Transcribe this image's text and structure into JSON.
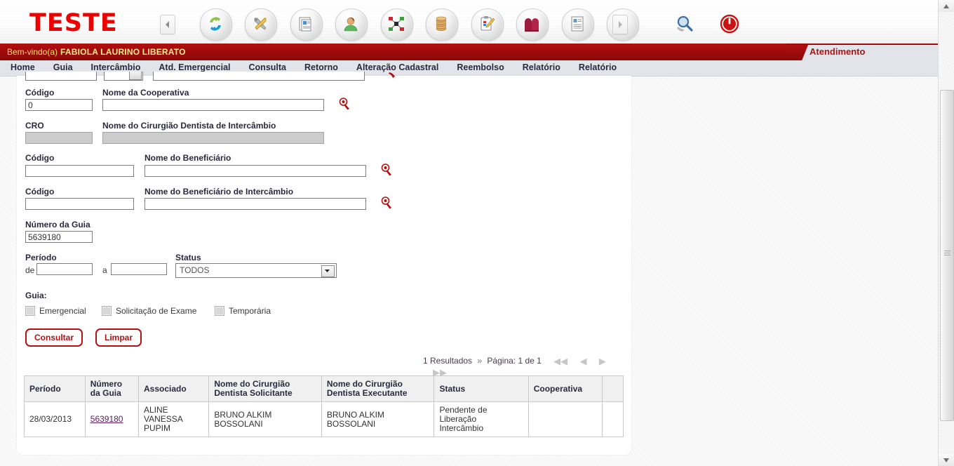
{
  "header": {
    "logo_text": "TESTE",
    "welcome_prefix": "Bem-vindo(a)",
    "user_name": "FABIOLA LAURINO LIBERATO",
    "active_tab": "Atendimento",
    "collapse_left_icon": "chevron-left-icon",
    "collapse_right_icon": "chevron-right-icon",
    "toolbar_icons": [
      {
        "name": "refresh-cycle-icon",
        "glyph": "↻"
      },
      {
        "name": "tools-icon",
        "glyph": "⚒"
      },
      {
        "name": "document-edit-icon",
        "glyph": "Ὄ4"
      },
      {
        "name": "user-profile-icon",
        "glyph": "὆4"
      },
      {
        "name": "network-nodes-icon",
        "glyph": "⬚"
      },
      {
        "name": "coins-stack-icon",
        "glyph": "ᾩ9"
      },
      {
        "name": "clipboard-pencil-icon",
        "glyph": "ὌB"
      },
      {
        "name": "arch-book-icon",
        "glyph": "ἽB"
      },
      {
        "name": "report-document-icon",
        "glyph": "὜E"
      },
      {
        "name": "search-document-icon",
        "glyph": "ὐE"
      },
      {
        "name": "magnifier-icon",
        "glyph": "ὐD"
      },
      {
        "name": "power-off-icon",
        "glyph": "⏻"
      }
    ]
  },
  "menu": {
    "items": [
      "Home",
      "Guia",
      "Intercâmbio",
      "Atd. Emergencial",
      "Consulta",
      "Retorno",
      "Alteração Cadastral",
      "Reembolso",
      "Relatório",
      "Relatório"
    ]
  },
  "form": {
    "cooperativa": {
      "codigo_label": "Código",
      "codigo_value": "0",
      "nome_label": "Nome da Cooperativa",
      "nome_value": "",
      "search_icon": "magnifier-search-icon"
    },
    "cirurgiao_intercambio": {
      "cro_label": "CRO",
      "cro_value": "",
      "nome_label": "Nome do Cirurgião Dentista de Intercâmbio",
      "nome_value": ""
    },
    "beneficiario": {
      "codigo_label": "Código",
      "codigo_value": "",
      "nome_label": "Nome do Beneficiário",
      "nome_value": "",
      "search_icon": "magnifier-search-icon"
    },
    "beneficiario_intercambio": {
      "codigo_label": "Código",
      "codigo_value": "",
      "nome_label": "Nome do Beneficiário de Intercâmbio",
      "nome_value": "",
      "search_icon": "magnifier-search-icon"
    },
    "numero_guia": {
      "label": "Número da Guia",
      "value": "5639180"
    },
    "periodo": {
      "label": "Período",
      "de_label": "de",
      "de_value": "",
      "a_label": "a",
      "a_value": ""
    },
    "status": {
      "label": "Status",
      "selected": "TODOS",
      "options": [
        "TODOS"
      ]
    },
    "guia": {
      "label": "Guia:",
      "checkboxes": [
        {
          "label": "Emergencial",
          "checked": false
        },
        {
          "label": "Solicitação de Exame",
          "checked": false
        },
        {
          "label": "Temporária",
          "checked": false
        }
      ]
    },
    "buttons": {
      "consultar": "Consultar",
      "limpar": "Limpar"
    }
  },
  "pagination": {
    "results_text": "1 Resultados",
    "separator": "»",
    "page_text": "Página: 1 de 1",
    "first_icon": "◀◀",
    "prev_icon": "◀",
    "next_icon": "▶",
    "last_icon": "▶▶"
  },
  "results_table": {
    "columns": [
      "Período",
      "Número\nda Guia",
      "Associado",
      "Nome do Cirurgião\nDentista Solicitante",
      "Nome do Cirurgião\nDentista Executante",
      "Status",
      "Cooperativa",
      ""
    ],
    "rows": [
      {
        "periodo": "28/03/2013",
        "numero_guia": "5639180",
        "associado": "ALINE\nVANESSA\nPUPIM",
        "solicitante": "BRUNO ALKIM BOSSOLANI",
        "executante": "BRUNO ALKIM BOSSOLANI",
        "status": "Pendente de Liberação\nIntercâmbio",
        "cooperativa": "",
        "extra": ""
      }
    ]
  },
  "colors": {
    "brand_red": "#b01212",
    "logo_red": "#ee0000",
    "welcome_bar": "#9e0b0b",
    "menu_bg": "#e3e3ea",
    "menu_text": "#29293f",
    "link": "#5a1a5a"
  }
}
